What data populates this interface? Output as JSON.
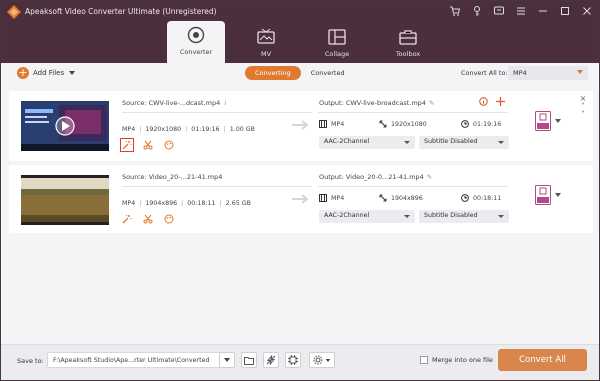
{
  "window": {
    "title": "Apeaksoft Video Converter Ultimate (Unregistered)"
  },
  "titlebar_icons": [
    "cart-icon",
    "key-icon",
    "feedback-icon",
    "menu-icon",
    "minimize-icon",
    "maximize-icon",
    "close-icon"
  ],
  "nav": {
    "tabs": [
      {
        "label": "Converter",
        "icon": "converter-icon",
        "active": true
      },
      {
        "label": "MV",
        "icon": "mv-icon",
        "active": false
      },
      {
        "label": "Collage",
        "icon": "collage-icon",
        "active": false
      },
      {
        "label": "Toolbox",
        "icon": "toolbox-icon",
        "active": false
      }
    ]
  },
  "toolbar": {
    "add_files": "Add Files",
    "seg_converting": "Converting",
    "seg_converted": "Converted",
    "convert_all_label": "Convert All to:",
    "convert_all_value": "MP4"
  },
  "files": [
    {
      "source": "Source: CWV-live-...dcast.mp4",
      "info": "i",
      "format": "MP4",
      "resolution": "1920x1080",
      "duration": "01:19:16",
      "size": "1.00 GB",
      "output": "Output: CWV-live-broadcast.mp4",
      "out_format": "MP4",
      "out_resolution": "1920x1080",
      "out_duration": "01:19:16",
      "audio": "AAC-2Channel",
      "subtitle": "Subtitle Disabled",
      "format_badge": "MP4"
    },
    {
      "source": "Source: Video_20-...21-41.mp4",
      "info": "",
      "format": "MP4",
      "resolution": "1904x896",
      "duration": "00:18:11",
      "size": "2.65 GB",
      "output": "Output: Video_20-0...21-41.mp4",
      "out_format": "MP4",
      "out_resolution": "1904x896",
      "out_duration": "00:18:11",
      "audio": "AAC-2Channel",
      "subtitle": "Subtitle Disabled",
      "format_badge": "MP4"
    }
  ],
  "footer": {
    "save_to_label": "Save to:",
    "save_path": "F:\\Apeaksoft Studio\\Ape...rter Ultimate\\Converted",
    "merge_label": "Merge into one file",
    "convert_all_button": "Convert All"
  },
  "colors": {
    "accent": "#e07a30",
    "titlebar": "#4b2f3d",
    "convert_button": "#d9864c",
    "selected_outline": "#e53935"
  }
}
